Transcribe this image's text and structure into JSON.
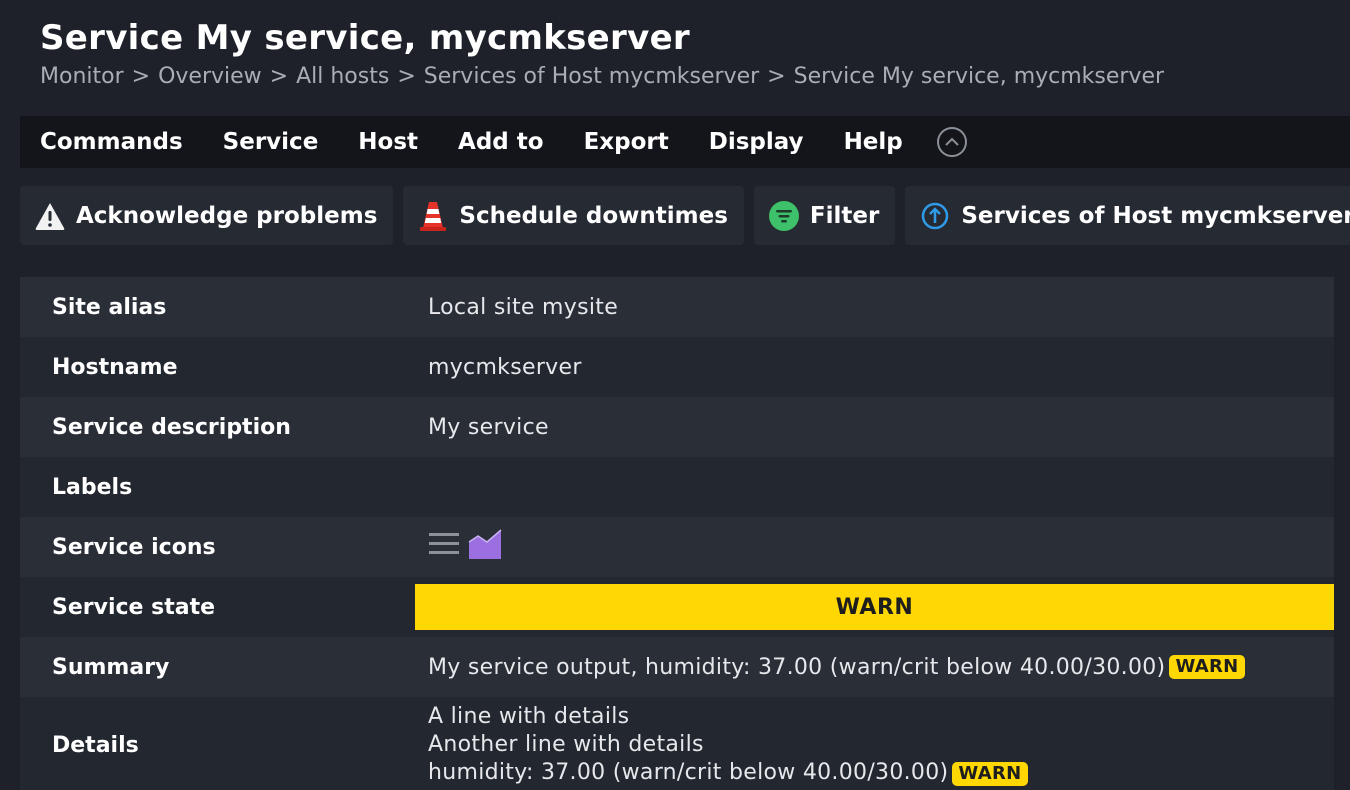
{
  "header": {
    "title": "Service My service, mycmkserver",
    "breadcrumb": [
      "Monitor",
      "Overview",
      "All hosts",
      "Services of Host mycmkserver",
      "Service My service, mycmkserver"
    ],
    "separator": ">"
  },
  "menu": {
    "items": [
      "Commands",
      "Service",
      "Host",
      "Add to",
      "Export",
      "Display",
      "Help"
    ],
    "collapse_icon": "chevron-up-circle-icon"
  },
  "actions": [
    {
      "label": "Acknowledge problems",
      "icon": "warning-triangle-icon"
    },
    {
      "label": "Schedule downtimes",
      "icon": "traffic-cone-icon"
    },
    {
      "label": "Filter",
      "icon": "filter-icon"
    },
    {
      "label": "Services of Host mycmkserver",
      "icon": "arrow-up-circle-icon"
    }
  ],
  "rows": {
    "site_alias": {
      "label": "Site alias",
      "value": "Local site mysite"
    },
    "hostname": {
      "label": "Hostname",
      "value": "mycmkserver"
    },
    "service_description": {
      "label": "Service description",
      "value": "My service"
    },
    "labels": {
      "label": "Labels",
      "value": ""
    },
    "service_icons": {
      "label": "Service icons",
      "icons": [
        "menu-icon",
        "graph-icon"
      ]
    },
    "service_state": {
      "label": "Service state",
      "value": "WARN"
    },
    "summary": {
      "label": "Summary",
      "text": "My service output, humidity: 37.00 (warn/crit below 40.00/30.00)",
      "badge": "WARN"
    },
    "details": {
      "label": "Details",
      "line1": "A line with details",
      "line2": "Another line with details",
      "line3": "humidity: 37.00 (warn/crit below 40.00/30.00)",
      "badge": "WARN"
    }
  },
  "colors": {
    "background": "#1e2129",
    "menubar": "#13151b",
    "warn": "#ffd703",
    "graph_icon": "#9b6fe0",
    "filter_icon": "#3ec16a",
    "link_icon": "#2f9be8",
    "cone_icon": "#e5332a"
  }
}
